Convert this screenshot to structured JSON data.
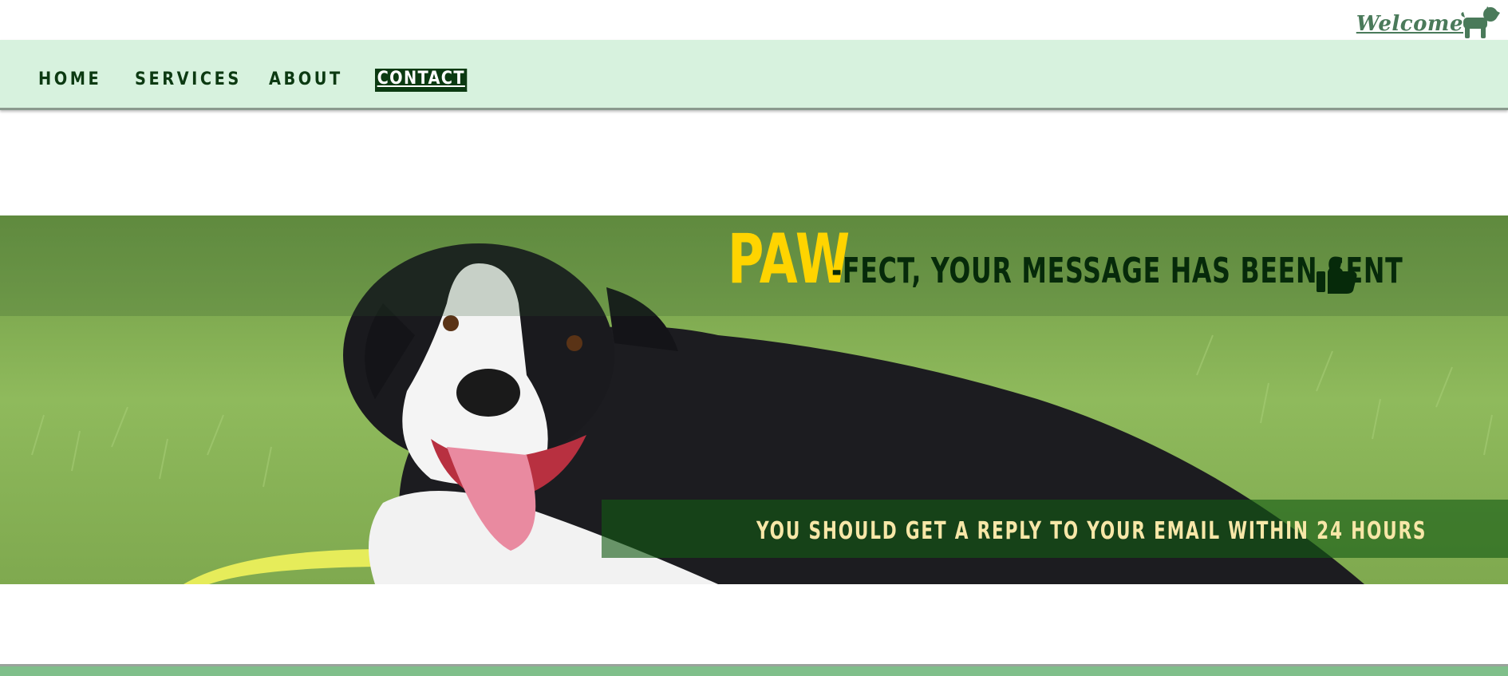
{
  "header": {
    "welcome_label": "Welcome",
    "logo_icon": "dog-icon"
  },
  "nav": {
    "items": [
      {
        "label": "HOME",
        "active": false
      },
      {
        "label": "SERVICES",
        "active": false
      },
      {
        "label": "ABOUT",
        "active": false
      },
      {
        "label": "CONTACT",
        "active": true
      }
    ]
  },
  "hero": {
    "headline_accent": "PAW",
    "headline_rest": "-FECT, YOUR MESSAGE HAS BEEN SENT",
    "headline_icon": "thumbs-up-icon",
    "reply_note": "YOU SHOULD GET A REPLY TO YOUR EMAIL WITHIN 24 HOURS"
  },
  "colors": {
    "nav_background": "#d7f2de",
    "nav_text": "#0c3a12",
    "accent_yellow": "#ffd400",
    "reply_text": "#f7e7a8",
    "footer": "#7fbf8a"
  }
}
